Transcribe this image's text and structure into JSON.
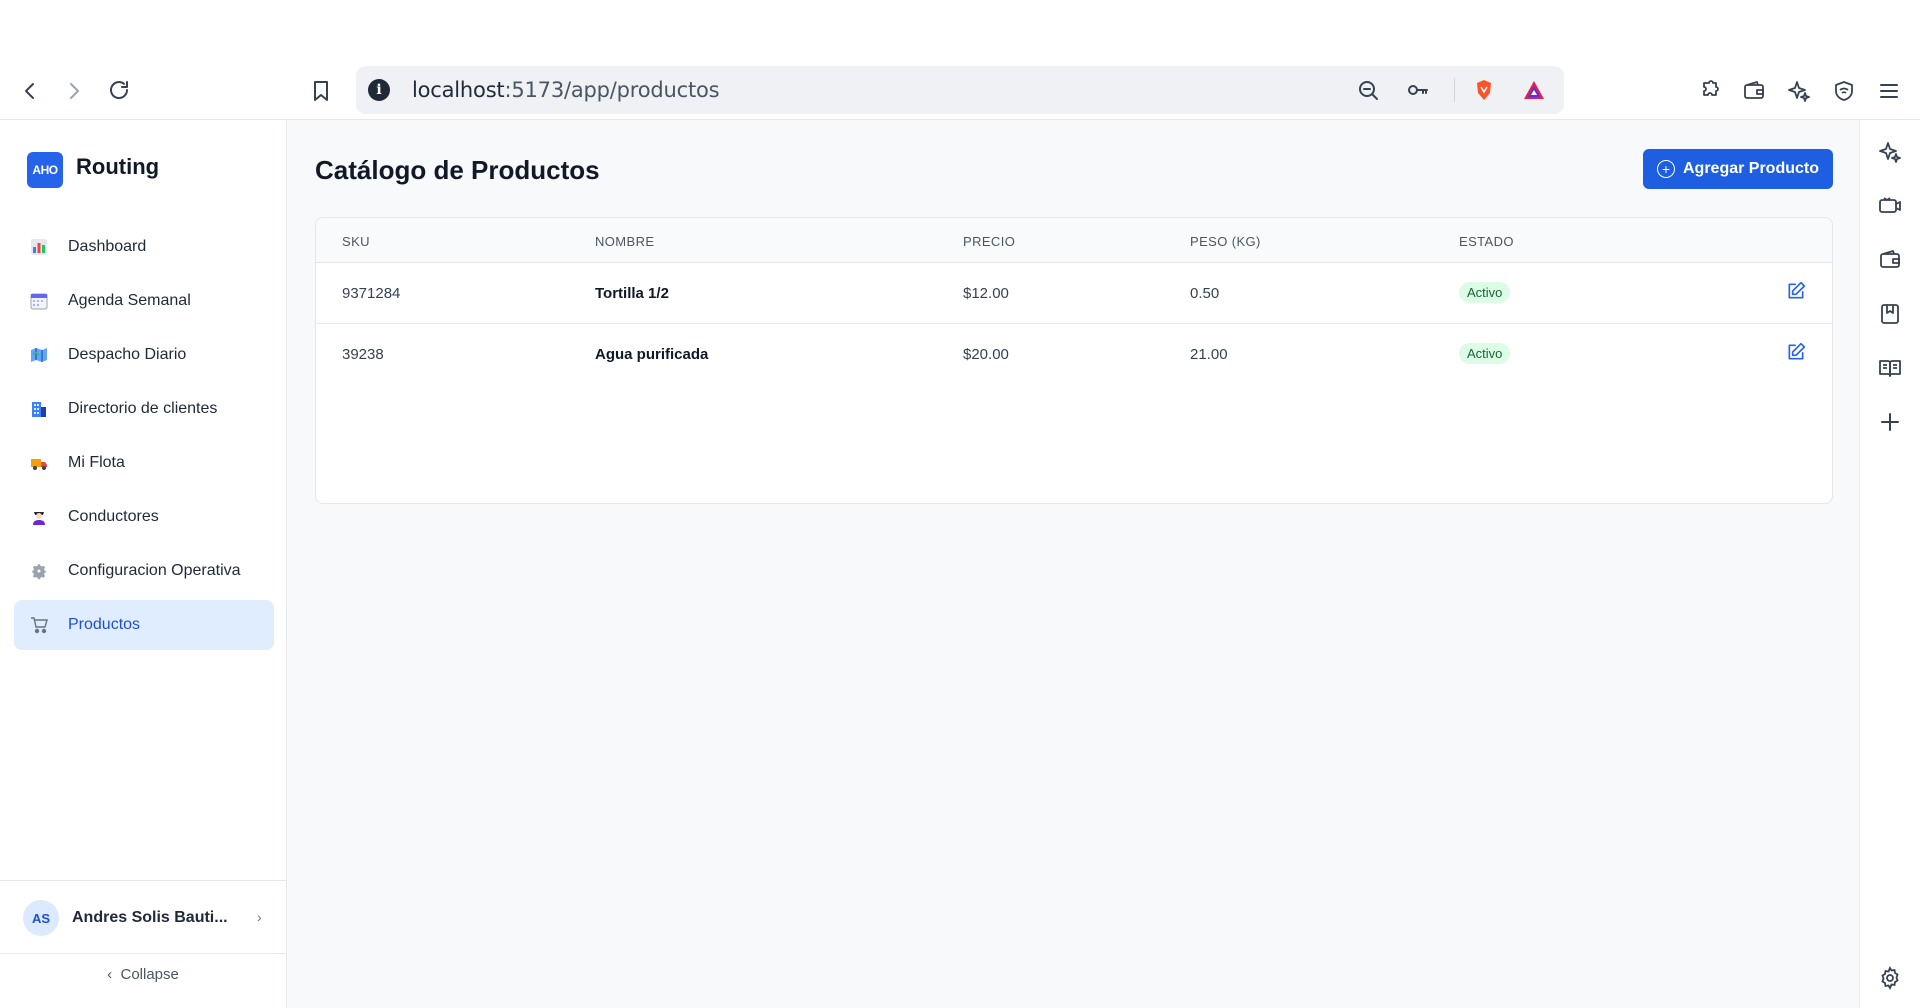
{
  "browser": {
    "url_host": "localhost",
    "url_path": ":5173/app/productos"
  },
  "sidebar": {
    "logo_text": "AHO",
    "brand": "Routing",
    "items": [
      {
        "label": "Dashboard",
        "icon": "bar-chart-icon",
        "active": false
      },
      {
        "label": "Agenda Semanal",
        "icon": "calendar-icon",
        "active": false
      },
      {
        "label": "Despacho Diario",
        "icon": "map-icon",
        "active": false
      },
      {
        "label": "Directorio de clientes",
        "icon": "building-icon",
        "active": false
      },
      {
        "label": "Mi Flota",
        "icon": "truck-icon",
        "active": false
      },
      {
        "label": "Conductores",
        "icon": "driver-icon",
        "active": false
      },
      {
        "label": "Configuracion Operativa",
        "icon": "gear-icon",
        "active": false
      },
      {
        "label": "Productos",
        "icon": "cart-icon",
        "active": true
      }
    ],
    "user": {
      "initials": "AS",
      "name": "Andres Solis Bauti..."
    },
    "collapse_label": "Collapse"
  },
  "main": {
    "title": "Catálogo de Productos",
    "add_button": "Agregar Producto",
    "table": {
      "headers": [
        "SKU",
        "NOMBRE",
        "PRECIO",
        "PESO (KG)",
        "ESTADO"
      ],
      "rows": [
        {
          "sku": "9371284",
          "nombre": "Tortilla 1/2",
          "precio": "$12.00",
          "peso": "0.50",
          "estado": "Activo"
        },
        {
          "sku": "39238",
          "nombre": "Agua purificada",
          "precio": "$20.00",
          "peso": "21.00",
          "estado": "Activo"
        }
      ]
    }
  },
  "colors": {
    "primary": "#1d5fe0",
    "active_nav_bg": "#e0edff",
    "badge_bg": "#dcfce7",
    "badge_text": "#166534"
  }
}
